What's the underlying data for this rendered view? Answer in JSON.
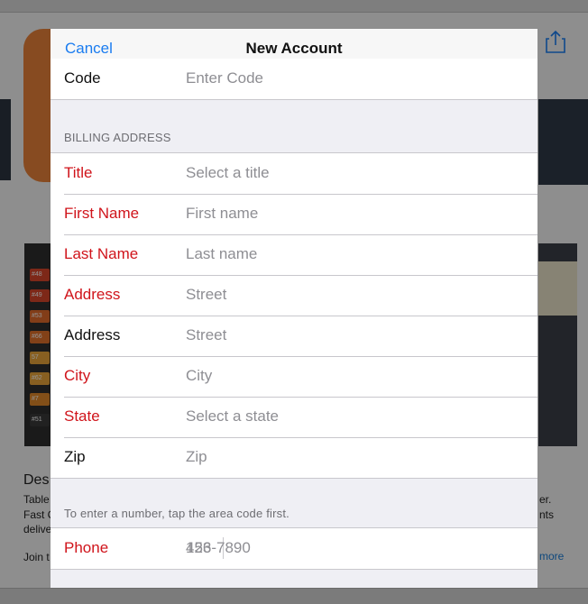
{
  "nav": {
    "cancel_label": "Cancel",
    "title": "New Account"
  },
  "code_row": {
    "label": "Code",
    "placeholder": "Enter Code"
  },
  "billing": {
    "header": "BILLING ADDRESS",
    "rows": [
      {
        "label": "Title",
        "placeholder": "Select a title",
        "required": true
      },
      {
        "label": "First Name",
        "placeholder": "First name",
        "required": true
      },
      {
        "label": "Last Name",
        "placeholder": "Last name",
        "required": true
      },
      {
        "label": "Address",
        "placeholder": "Street",
        "required": true
      },
      {
        "label": "Address",
        "placeholder": "Street",
        "required": false
      },
      {
        "label": "City",
        "placeholder": "City",
        "required": true
      },
      {
        "label": "State",
        "placeholder": "Select a state",
        "required": true
      },
      {
        "label": "Zip",
        "placeholder": "Zip",
        "required": false
      }
    ]
  },
  "phone": {
    "hint": "To enter a number, tap the area code first.",
    "label": "Phone",
    "area_placeholder": "123",
    "number_placeholder": "456-7890"
  },
  "background": {
    "desc_heading": "Des",
    "more_link": "more",
    "line1": "Table",
    "line2": "Fast C",
    "line3": "delive",
    "line4": "Join t",
    "right1": "er.",
    "right2": "nts",
    "left_rows": [
      "#48",
      "#49",
      "#53",
      "#66",
      "57",
      "#62",
      "#7",
      "#51"
    ]
  },
  "colors": {
    "accent": "#1a7cf0",
    "required": "#d0141b",
    "placeholder": "#8e8e93",
    "grouped_bg": "#efeff4"
  }
}
